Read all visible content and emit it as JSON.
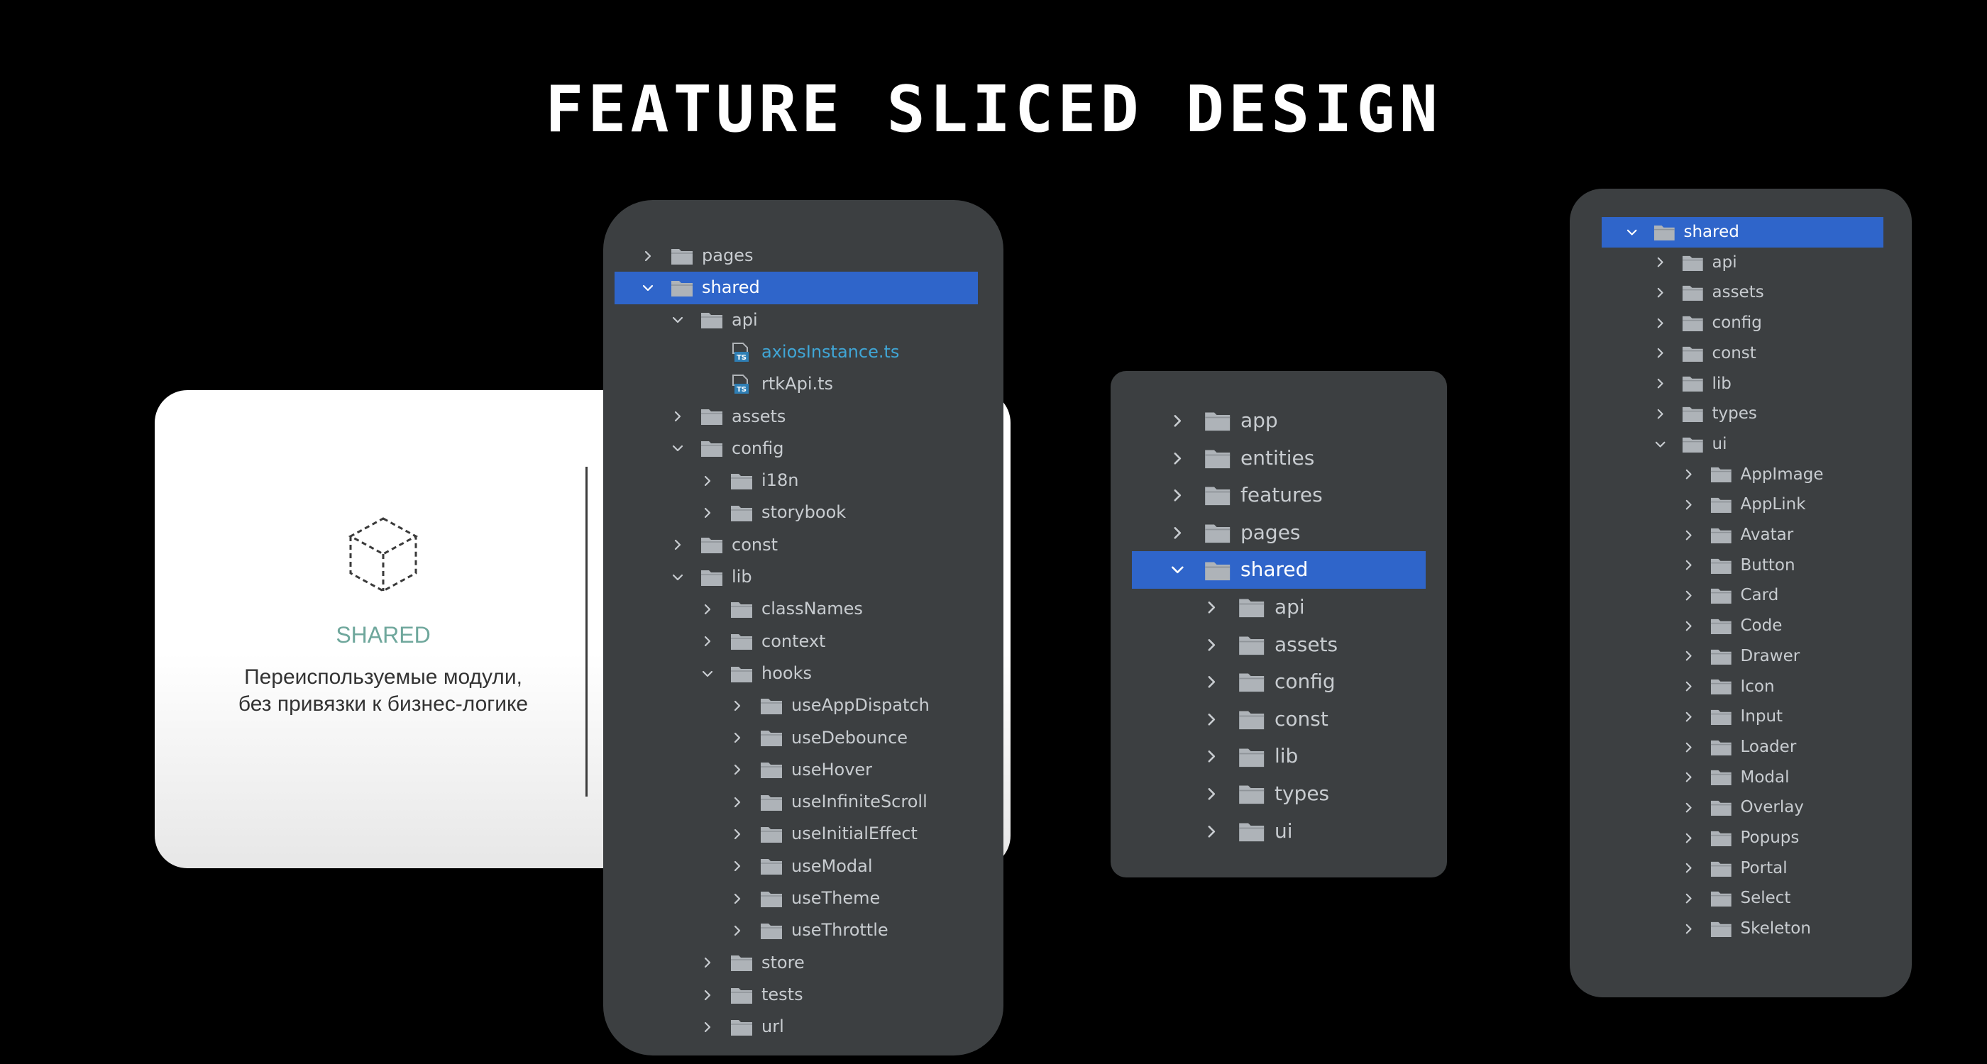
{
  "title": "FEATURE SLICED DESIGN",
  "card": {
    "label": "SHARED",
    "description_line1": "Переиспользуемые модули,",
    "description_line2": "без привязки к бизнес-логике"
  },
  "colors": {
    "background": "#000000",
    "panel": "#3c3f41",
    "selection": "#2f65ca",
    "text": "#c8ccd0",
    "highlight_file": "#40a6d6",
    "card_label": "#6fa79c"
  },
  "panels": [
    {
      "name": "tree-panel-detailed",
      "items": [
        {
          "label": "pages",
          "depth": 0,
          "kind": "folder",
          "chevron": "right"
        },
        {
          "label": "shared",
          "depth": 0,
          "kind": "folder",
          "chevron": "down",
          "selected": true
        },
        {
          "label": "api",
          "depth": 1,
          "kind": "folder",
          "chevron": "down"
        },
        {
          "label": "axiosInstance.ts",
          "depth": 2,
          "kind": "ts-file",
          "chevron": "none",
          "highlighted": true
        },
        {
          "label": "rtkApi.ts",
          "depth": 2,
          "kind": "ts-file",
          "chevron": "none"
        },
        {
          "label": "assets",
          "depth": 1,
          "kind": "folder",
          "chevron": "right"
        },
        {
          "label": "config",
          "depth": 1,
          "kind": "folder",
          "chevron": "down"
        },
        {
          "label": "i18n",
          "depth": 2,
          "kind": "folder",
          "chevron": "right"
        },
        {
          "label": "storybook",
          "depth": 2,
          "kind": "folder",
          "chevron": "right"
        },
        {
          "label": "const",
          "depth": 1,
          "kind": "folder",
          "chevron": "right"
        },
        {
          "label": "lib",
          "depth": 1,
          "kind": "folder",
          "chevron": "down"
        },
        {
          "label": "classNames",
          "depth": 2,
          "kind": "folder",
          "chevron": "right"
        },
        {
          "label": "context",
          "depth": 2,
          "kind": "folder",
          "chevron": "right"
        },
        {
          "label": "hooks",
          "depth": 2,
          "kind": "folder",
          "chevron": "down"
        },
        {
          "label": "useAppDispatch",
          "depth": 3,
          "kind": "folder",
          "chevron": "right"
        },
        {
          "label": "useDebounce",
          "depth": 3,
          "kind": "folder",
          "chevron": "right"
        },
        {
          "label": "useHover",
          "depth": 3,
          "kind": "folder",
          "chevron": "right"
        },
        {
          "label": "useInfiniteScroll",
          "depth": 3,
          "kind": "folder",
          "chevron": "right"
        },
        {
          "label": "useInitialEffect",
          "depth": 3,
          "kind": "folder",
          "chevron": "right"
        },
        {
          "label": "useModal",
          "depth": 3,
          "kind": "folder",
          "chevron": "right"
        },
        {
          "label": "useTheme",
          "depth": 3,
          "kind": "folder",
          "chevron": "right"
        },
        {
          "label": "useThrottle",
          "depth": 3,
          "kind": "folder",
          "chevron": "right"
        },
        {
          "label": "store",
          "depth": 2,
          "kind": "folder",
          "chevron": "right"
        },
        {
          "label": "tests",
          "depth": 2,
          "kind": "folder",
          "chevron": "right"
        },
        {
          "label": "url",
          "depth": 2,
          "kind": "folder",
          "chevron": "right"
        }
      ]
    },
    {
      "name": "tree-panel-layers",
      "items": [
        {
          "label": "app",
          "depth": 0,
          "kind": "folder",
          "chevron": "right"
        },
        {
          "label": "entities",
          "depth": 0,
          "kind": "folder",
          "chevron": "right"
        },
        {
          "label": "features",
          "depth": 0,
          "kind": "folder",
          "chevron": "right"
        },
        {
          "label": "pages",
          "depth": 0,
          "kind": "folder",
          "chevron": "right"
        },
        {
          "label": "shared",
          "depth": 0,
          "kind": "folder",
          "chevron": "down",
          "selected": true
        },
        {
          "label": "api",
          "depth": 1,
          "kind": "folder",
          "chevron": "right"
        },
        {
          "label": "assets",
          "depth": 1,
          "kind": "folder",
          "chevron": "right"
        },
        {
          "label": "config",
          "depth": 1,
          "kind": "folder",
          "chevron": "right"
        },
        {
          "label": "const",
          "depth": 1,
          "kind": "folder",
          "chevron": "right"
        },
        {
          "label": "lib",
          "depth": 1,
          "kind": "folder",
          "chevron": "right"
        },
        {
          "label": "types",
          "depth": 1,
          "kind": "folder",
          "chevron": "right"
        },
        {
          "label": "ui",
          "depth": 1,
          "kind": "folder",
          "chevron": "right"
        }
      ]
    },
    {
      "name": "tree-panel-ui",
      "items": [
        {
          "label": "shared",
          "depth": 0,
          "kind": "folder",
          "chevron": "down",
          "selected": true
        },
        {
          "label": "api",
          "depth": 1,
          "kind": "folder",
          "chevron": "right"
        },
        {
          "label": "assets",
          "depth": 1,
          "kind": "folder",
          "chevron": "right"
        },
        {
          "label": "config",
          "depth": 1,
          "kind": "folder",
          "chevron": "right"
        },
        {
          "label": "const",
          "depth": 1,
          "kind": "folder",
          "chevron": "right"
        },
        {
          "label": "lib",
          "depth": 1,
          "kind": "folder",
          "chevron": "right"
        },
        {
          "label": "types",
          "depth": 1,
          "kind": "folder",
          "chevron": "right"
        },
        {
          "label": "ui",
          "depth": 1,
          "kind": "folder",
          "chevron": "down"
        },
        {
          "label": "AppImage",
          "depth": 2,
          "kind": "folder",
          "chevron": "right"
        },
        {
          "label": "AppLink",
          "depth": 2,
          "kind": "folder",
          "chevron": "right"
        },
        {
          "label": "Avatar",
          "depth": 2,
          "kind": "folder",
          "chevron": "right"
        },
        {
          "label": "Button",
          "depth": 2,
          "kind": "folder",
          "chevron": "right"
        },
        {
          "label": "Card",
          "depth": 2,
          "kind": "folder",
          "chevron": "right"
        },
        {
          "label": "Code",
          "depth": 2,
          "kind": "folder",
          "chevron": "right"
        },
        {
          "label": "Drawer",
          "depth": 2,
          "kind": "folder",
          "chevron": "right"
        },
        {
          "label": "Icon",
          "depth": 2,
          "kind": "folder",
          "chevron": "right"
        },
        {
          "label": "Input",
          "depth": 2,
          "kind": "folder",
          "chevron": "right"
        },
        {
          "label": "Loader",
          "depth": 2,
          "kind": "folder",
          "chevron": "right"
        },
        {
          "label": "Modal",
          "depth": 2,
          "kind": "folder",
          "chevron": "right"
        },
        {
          "label": "Overlay",
          "depth": 2,
          "kind": "folder",
          "chevron": "right"
        },
        {
          "label": "Popups",
          "depth": 2,
          "kind": "folder",
          "chevron": "right"
        },
        {
          "label": "Portal",
          "depth": 2,
          "kind": "folder",
          "chevron": "right"
        },
        {
          "label": "Select",
          "depth": 2,
          "kind": "folder",
          "chevron": "right"
        },
        {
          "label": "Skeleton",
          "depth": 2,
          "kind": "folder",
          "chevron": "right"
        }
      ]
    }
  ]
}
